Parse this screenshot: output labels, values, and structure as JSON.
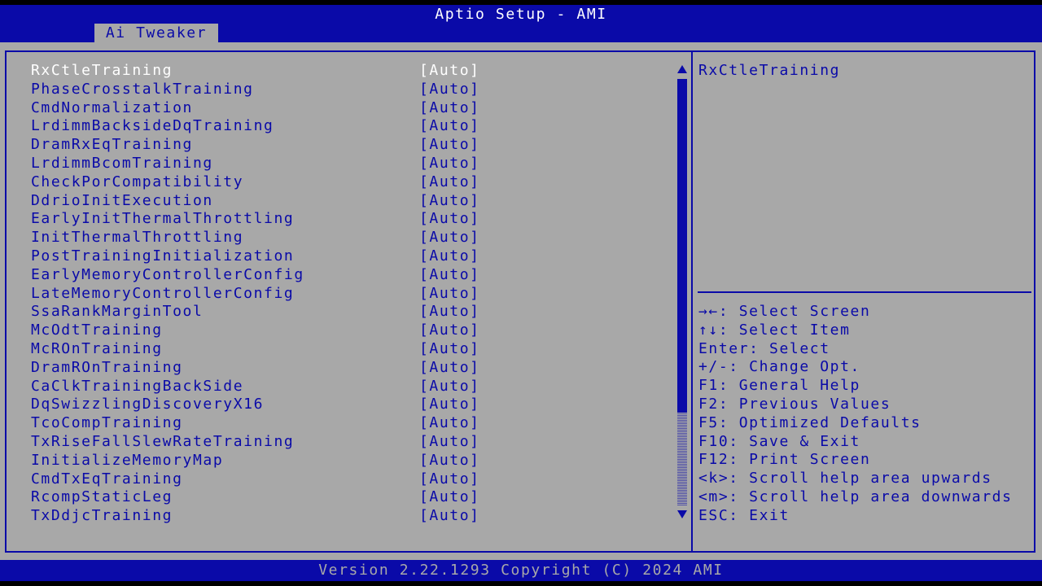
{
  "header": {
    "title": "Aptio Setup - AMI",
    "tab_label": "Ai Tweaker"
  },
  "items": [
    {
      "label": "RxCtleTraining",
      "value": "[Auto]"
    },
    {
      "label": "PhaseCrosstalkTraining",
      "value": "[Auto]"
    },
    {
      "label": "CmdNormalization",
      "value": "[Auto]"
    },
    {
      "label": "LrdimmBacksideDqTraining",
      "value": "[Auto]"
    },
    {
      "label": "DramRxEqTraining",
      "value": "[Auto]"
    },
    {
      "label": "LrdimmBcomTraining",
      "value": "[Auto]"
    },
    {
      "label": "CheckPorCompatibility",
      "value": "[Auto]"
    },
    {
      "label": "DdrioInitExecution",
      "value": "[Auto]"
    },
    {
      "label": "EarlyInitThermalThrottling",
      "value": "[Auto]"
    },
    {
      "label": "InitThermalThrottling",
      "value": "[Auto]"
    },
    {
      "label": "PostTrainingInitialization",
      "value": "[Auto]"
    },
    {
      "label": "EarlyMemoryControllerConfig",
      "value": "[Auto]"
    },
    {
      "label": "LateMemoryControllerConfig",
      "value": "[Auto]"
    },
    {
      "label": "SsaRankMarginTool",
      "value": "[Auto]"
    },
    {
      "label": "McOdtTraining",
      "value": "[Auto]"
    },
    {
      "label": "McROnTraining",
      "value": "[Auto]"
    },
    {
      "label": "DramROnTraining",
      "value": "[Auto]"
    },
    {
      "label": "CaClkTrainingBackSide",
      "value": "[Auto]"
    },
    {
      "label": "DqSwizzlingDiscoveryX16",
      "value": "[Auto]"
    },
    {
      "label": "TcoCompTraining",
      "value": "[Auto]"
    },
    {
      "label": "TxRiseFallSlewRateTraining",
      "value": "[Auto]"
    },
    {
      "label": "InitializeMemoryMap",
      "value": "[Auto]"
    },
    {
      "label": "CmdTxEqTraining",
      "value": "[Auto]"
    },
    {
      "label": "RcompStaticLeg",
      "value": "[Auto]"
    },
    {
      "label": "TxDdjcTraining",
      "value": "[Auto]"
    }
  ],
  "selected_index": 0,
  "help": {
    "title": "RxCtleTraining"
  },
  "keys": [
    "→←: Select Screen",
    "↑↓: Select Item",
    "Enter: Select",
    "+/-: Change Opt.",
    "F1: General Help",
    "F2: Previous Values",
    "F5: Optimized Defaults",
    "F10: Save & Exit",
    "F12: Print Screen",
    "<k>: Scroll help area upwards",
    "<m>: Scroll help area downwards",
    "ESC: Exit"
  ],
  "footer": {
    "version": "Version 2.22.1293 Copyright (C) 2024 AMI"
  },
  "colors": {
    "bios_blue": "#0a0aa8",
    "bios_gray": "#a8a8a8",
    "selected_text": "#ffffff"
  },
  "scrollbar": {
    "thumb_position_fraction": 0.0,
    "visible_fraction": 0.78
  }
}
